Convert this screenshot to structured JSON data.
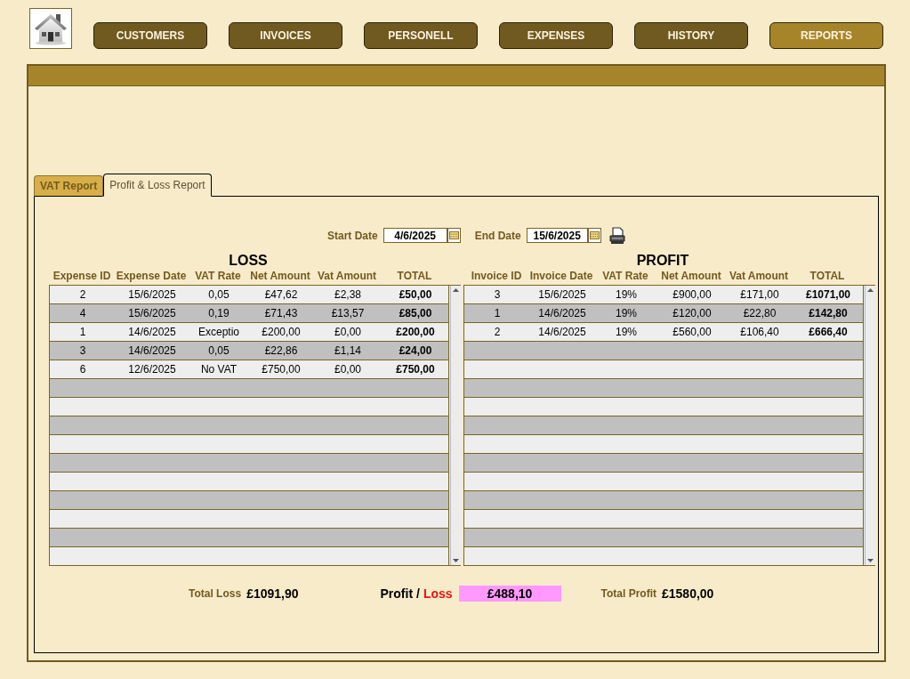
{
  "nav": [
    {
      "label": "CUSTOMERS",
      "selected": false
    },
    {
      "label": "INVOICES",
      "selected": false
    },
    {
      "label": "PERSONELL",
      "selected": false
    },
    {
      "label": "EXPENSES",
      "selected": false
    },
    {
      "label": "HISTORY",
      "selected": false
    },
    {
      "label": "REPORTS",
      "selected": true
    }
  ],
  "tabs": [
    {
      "label": "VAT Report",
      "selected": false
    },
    {
      "label": "Profit & Loss Report",
      "selected": true
    }
  ],
  "date_range": {
    "start_label": "Start Date",
    "start_date": "4/6/2025",
    "end_label": "End Date",
    "end_date": "15/6/2025"
  },
  "loss": {
    "title": "LOSS",
    "columns": [
      "Expense ID",
      "Expense Date",
      "VAT Rate",
      "Net Amount",
      "Vat Amount",
      "TOTAL"
    ],
    "rows": [
      [
        "2",
        "15/6/2025",
        "0,05",
        "£47,62",
        "£2,38",
        "£50,00"
      ],
      [
        "4",
        "15/6/2025",
        "0,19",
        "£71,43",
        "£13,57",
        "£85,00"
      ],
      [
        "1",
        "14/6/2025",
        "Exceptio",
        "£200,00",
        "£0,00",
        "£200,00"
      ],
      [
        "3",
        "14/6/2025",
        "0,05",
        "£22,86",
        "£1,14",
        "£24,00"
      ],
      [
        "6",
        "12/6/2025",
        "No VAT",
        "£750,00",
        "£0,00",
        "£750,00"
      ]
    ]
  },
  "profit": {
    "title": "PROFIT",
    "columns": [
      "Invoice ID",
      "Invoice Date",
      "VAT Rate",
      "Net Amount",
      "Vat Amount",
      "TOTAL"
    ],
    "rows": [
      [
        "3",
        "15/6/2025",
        "19%",
        "£900,00",
        "£171,00",
        "£1071,00"
      ],
      [
        "1",
        "14/6/2025",
        "19%",
        "£120,00",
        "£22,80",
        "£142,80"
      ],
      [
        "2",
        "14/6/2025",
        "19%",
        "£560,00",
        "£106,40",
        "£666,40"
      ]
    ]
  },
  "summary": {
    "total_loss_label": "Total Loss",
    "total_loss": "£1091,90",
    "balance_label": "Profit /",
    "balance_loss_label": "Loss",
    "balance": "£488,10",
    "total_profit_label": "Total Profit",
    "total_profit": "£1580,00"
  }
}
